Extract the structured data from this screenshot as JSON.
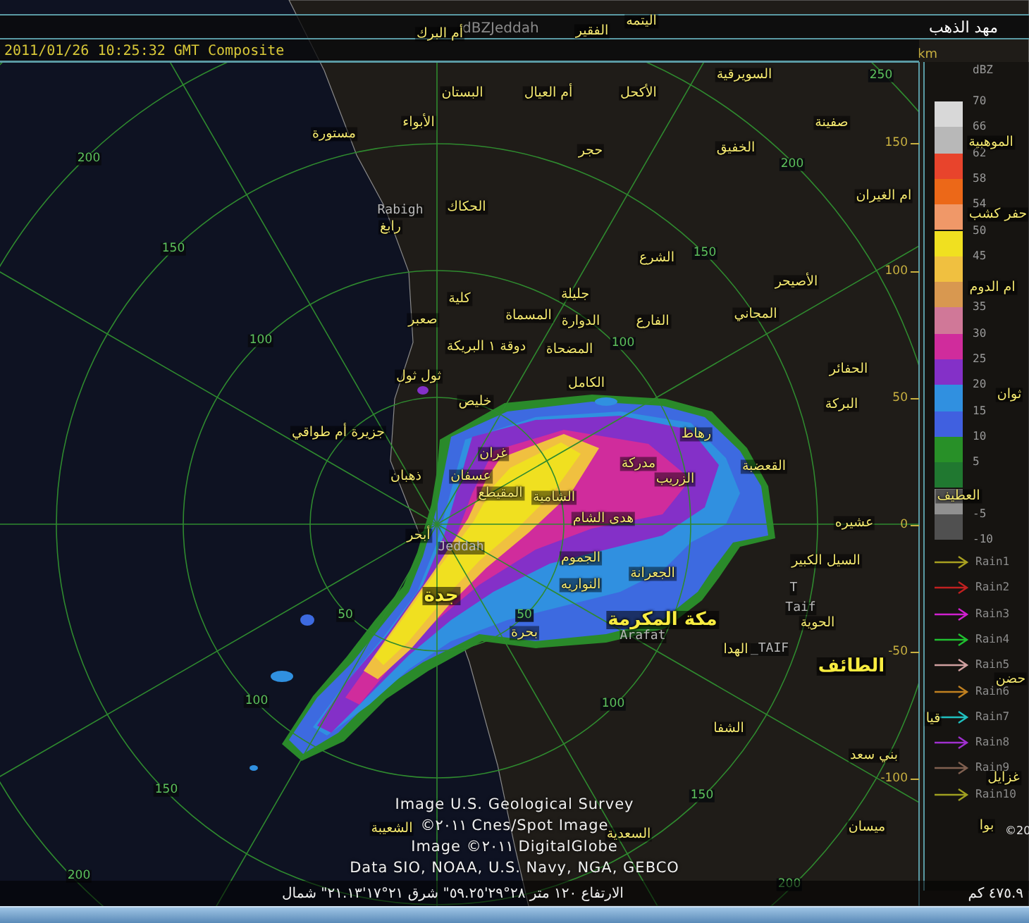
{
  "header": {
    "radar_name": "dBZJeddah",
    "place": "مهد الذهب"
  },
  "title_bar": {
    "timestamp": "2011/01/26 10:25:32 GMT Composite"
  },
  "km_axis": {
    "unit": "km",
    "ticks": [
      "150",
      "100",
      "50",
      "0",
      "-50",
      "-100"
    ]
  },
  "ring_labels": [
    "200",
    "150",
    "100",
    "200",
    "150",
    "100",
    "50",
    "100",
    "150",
    "200",
    "50",
    "100",
    "150",
    "200",
    "250"
  ],
  "place_labels": [
    {
      "text": "اليتمه",
      "kind": "town"
    },
    {
      "text": "الفقير",
      "kind": "town"
    },
    {
      "text": "أم البرك",
      "kind": "town"
    },
    {
      "text": "السويرقية",
      "kind": "town"
    },
    {
      "text": "الأكحل",
      "kind": "town"
    },
    {
      "text": "أم العيال",
      "kind": "town"
    },
    {
      "text": "البستان",
      "kind": "town"
    },
    {
      "text": "صفينة",
      "kind": "town"
    },
    {
      "text": "الأبواء",
      "kind": "town"
    },
    {
      "text": "مستورة",
      "kind": "town"
    },
    {
      "text": "الموهبية",
      "kind": "town"
    },
    {
      "text": "الخفيق",
      "kind": "town"
    },
    {
      "text": "حجر",
      "kind": "town"
    },
    {
      "text": "ام الغيران",
      "kind": "town"
    },
    {
      "text": "حفر كشب",
      "kind": "town"
    },
    {
      "text": "الحكاك",
      "kind": "town"
    },
    {
      "text": "Rabigh",
      "kind": "english"
    },
    {
      "text": "رابغ",
      "kind": "town"
    },
    {
      "text": "الشرع",
      "kind": "town"
    },
    {
      "text": "ام الدوم",
      "kind": "town"
    },
    {
      "text": "الأصيحر",
      "kind": "town"
    },
    {
      "text": "جليلة",
      "kind": "town"
    },
    {
      "text": "كلية",
      "kind": "town"
    },
    {
      "text": "المحاني",
      "kind": "town"
    },
    {
      "text": "الفارع",
      "kind": "town"
    },
    {
      "text": "الدوارة",
      "kind": "town"
    },
    {
      "text": "المسماة",
      "kind": "town"
    },
    {
      "text": "صعبر",
      "kind": "town"
    },
    {
      "text": "المضحاة",
      "kind": "town"
    },
    {
      "text": "دوقة ١ البريكة",
      "kind": "town"
    },
    {
      "text": "الحفائر",
      "kind": "town"
    },
    {
      "text": "الكامل",
      "kind": "town"
    },
    {
      "text": "ثول ثول",
      "kind": "town"
    },
    {
      "text": "ثوان",
      "kind": "town"
    },
    {
      "text": "البركة",
      "kind": "town"
    },
    {
      "text": "خليص",
      "kind": "town"
    },
    {
      "text": "رهاط",
      "kind": "town"
    },
    {
      "text": "جزيرة أم طواقي",
      "kind": "town"
    },
    {
      "text": "مدركة",
      "kind": "town"
    },
    {
      "text": "غران",
      "kind": "town"
    },
    {
      "text": "القعضبة",
      "kind": "town"
    },
    {
      "text": "الزريب",
      "kind": "town"
    },
    {
      "text": "عسفان",
      "kind": "town"
    },
    {
      "text": "ذهبان",
      "kind": "town"
    },
    {
      "text": "العطيف",
      "kind": "town"
    },
    {
      "text": "الشامية",
      "kind": "town"
    },
    {
      "text": "المقيطع",
      "kind": "town"
    },
    {
      "text": "عشيره",
      "kind": "town"
    },
    {
      "text": "هدى الشام",
      "kind": "town"
    },
    {
      "text": "Jeddah",
      "kind": "english"
    },
    {
      "text": "أبحر",
      "kind": "town"
    },
    {
      "text": "السيل الكبير",
      "kind": "town"
    },
    {
      "text": "الجموم",
      "kind": "town"
    },
    {
      "text": "الجعرانة",
      "kind": "town"
    },
    {
      "text": "T",
      "kind": "english"
    },
    {
      "text": "النواريه",
      "kind": "town"
    },
    {
      "text": "Taif",
      "kind": "english"
    },
    {
      "text": "جدة",
      "kind": "city"
    },
    {
      "text": "الحوية",
      "kind": "town"
    },
    {
      "text": "مكة المكرمة",
      "kind": "city"
    },
    {
      "text": "Arafat",
      "kind": "english"
    },
    {
      "text": "بحرة",
      "kind": "town"
    },
    {
      "text": "_TAIF",
      "kind": "english"
    },
    {
      "text": "الهدا",
      "kind": "town"
    },
    {
      "text": "حضن",
      "kind": "town"
    },
    {
      "text": "الطائف",
      "kind": "city"
    },
    {
      "text": "قيا",
      "kind": "town"
    },
    {
      "text": "الشفا",
      "kind": "town"
    },
    {
      "text": "غزايل",
      "kind": "town"
    },
    {
      "text": "بني سعد",
      "kind": "town"
    },
    {
      "text": "©20",
      "kind": "credit"
    },
    {
      "text": "بوا",
      "kind": "town"
    },
    {
      "text": "ميسان",
      "kind": "town"
    },
    {
      "text": "السعدية",
      "kind": "town"
    },
    {
      "text": "الشعيبة",
      "kind": "town"
    }
  ],
  "legend": {
    "unit": "dBZ",
    "scale": [
      {
        "color": "#d8d8d8"
      },
      {
        "color": "#b8b8b8"
      },
      {
        "color": "#e8442c"
      },
      {
        "color": "#ec6818"
      },
      {
        "color": "#f09868"
      },
      {
        "color": "#f0e020"
      },
      {
        "color": "#f0c040"
      },
      {
        "color": "#d89850"
      },
      {
        "color": "#d07898"
      },
      {
        "color": "#d02c9c"
      },
      {
        "color": "#8430c8"
      },
      {
        "color": "#3090e0"
      },
      {
        "color": "#4060e0"
      },
      {
        "color": "#289028"
      },
      {
        "color": "#207830"
      },
      {
        "color": "#909090"
      },
      {
        "color": "#505050"
      }
    ],
    "ticks": [
      "70",
      "66",
      "62",
      "58",
      "54",
      "50",
      "45",
      "35",
      "30",
      "25",
      "20",
      "15",
      "10",
      "5",
      "-5",
      "-10"
    ]
  },
  "tracks_legend": [
    {
      "label": "Rain1",
      "color": "#a8a020"
    },
    {
      "label": "Rain2",
      "color": "#c02020"
    },
    {
      "label": "Rain3",
      "color": "#d020d0"
    },
    {
      "label": "Rain4",
      "color": "#20c030"
    },
    {
      "label": "Rain5",
      "color": "#d0a0a0"
    },
    {
      "label": "Rain6",
      "color": "#c08020"
    },
    {
      "label": "Rain7",
      "color": "#20c0c0"
    },
    {
      "label": "Rain8",
      "color": "#a030d0"
    },
    {
      "label": "Rain9",
      "color": "#806050"
    },
    {
      "label": "Rain10",
      "color": "#a0a020"
    }
  ],
  "attribution": [
    "Image U.S. Geological Survey",
    "©٢٠١١ Cnes/Spot Image",
    "Image ©٢٠١١ DigitalGlobe",
    "Data SIO, NOAA, U.S. Navy, NGA, GEBCO"
  ],
  "status_bar": {
    "coordinates": "الارتفاع ١٢٠ متر   ٢٨°٢٩'٥٩.٢٥\" شرق   ٢١°١٧'٢١.١٣\" شمال",
    "eye_altitude": "٤٧٥.٩ كم"
  }
}
